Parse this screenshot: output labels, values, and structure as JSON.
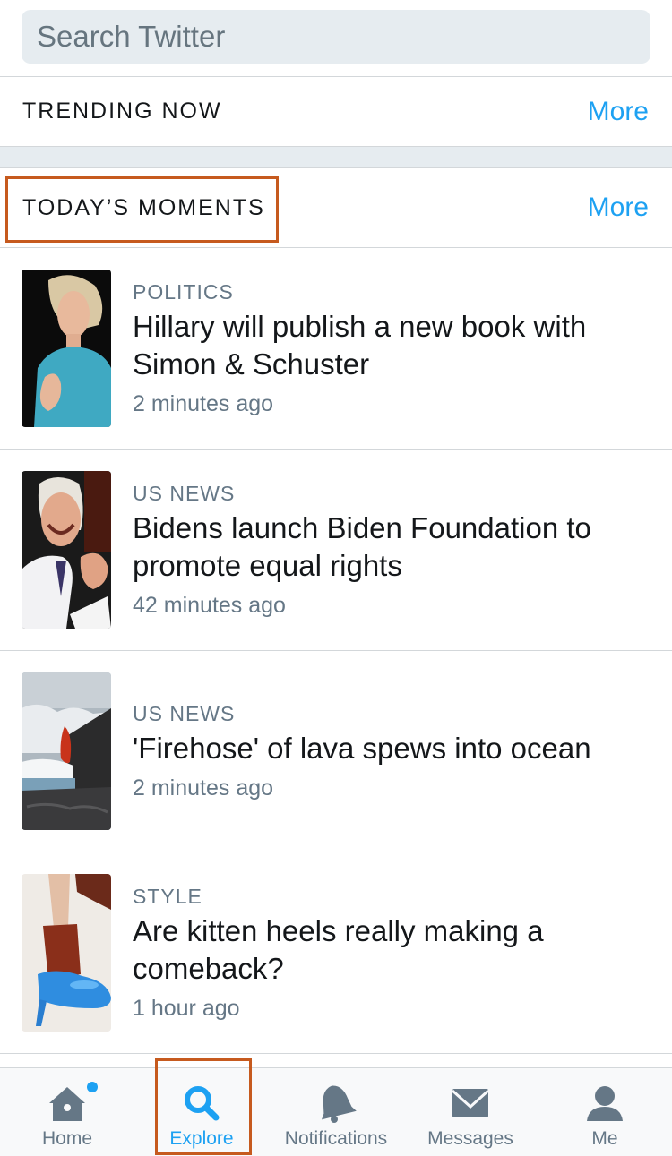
{
  "search": {
    "placeholder": "Search Twitter"
  },
  "trending": {
    "title": "TRENDING NOW",
    "more_label": "More"
  },
  "moments": {
    "title": "TODAY’S MOMENTS",
    "more_label": "More",
    "items": [
      {
        "category": "POLITICS",
        "title": "Hillary will publish a new book with Simon & Schuster",
        "time": "2 minutes ago"
      },
      {
        "category": "US NEWS",
        "title": "Bidens launch Biden Foundation to promote equal rights",
        "time": "42 minutes ago"
      },
      {
        "category": "US NEWS",
        "title": "'Firehose' of lava spews into ocean",
        "time": "2 minutes ago"
      },
      {
        "category": "STYLE",
        "title": "Are kitten heels really making a comeback?",
        "time": "1 hour ago"
      }
    ]
  },
  "tabbar": {
    "tabs": [
      {
        "label": "Home",
        "icon": "home-icon"
      },
      {
        "label": "Explore",
        "icon": "search-icon",
        "active": true
      },
      {
        "label": "Notifications",
        "icon": "bell-icon"
      },
      {
        "label": "Messages",
        "icon": "envelope-icon"
      },
      {
        "label": "Me",
        "icon": "person-icon"
      }
    ]
  },
  "colors": {
    "accent": "#1da1f2",
    "secondary_text": "#657786",
    "highlight_border": "#c65a1e",
    "section_gap": "#e6ecf0"
  }
}
